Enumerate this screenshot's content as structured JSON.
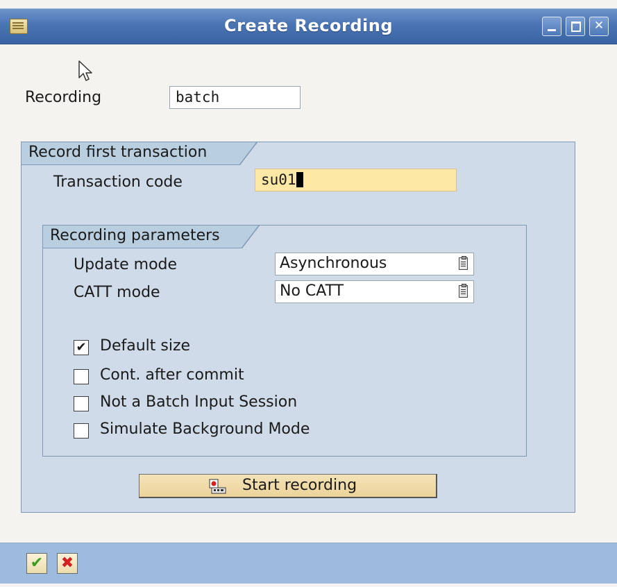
{
  "window": {
    "title": "Create Recording"
  },
  "recording": {
    "label": "Recording",
    "value": "batch"
  },
  "first_transaction": {
    "group_title": "Record first transaction",
    "tcode_label": "Transaction code",
    "tcode_value": "su01"
  },
  "parameters": {
    "group_title": "Recording parameters",
    "update_mode_label": "Update mode",
    "update_mode_value": "Asynchronous",
    "catt_mode_label": "CATT mode",
    "catt_mode_value": "No CATT",
    "checkboxes": [
      {
        "label": "Default size",
        "checked": true
      },
      {
        "label": "Cont. after commit",
        "checked": false
      },
      {
        "label": "Not a Batch Input Session",
        "checked": false
      },
      {
        "label": "Simulate Background Mode",
        "checked": false
      }
    ]
  },
  "actions": {
    "start_recording": "Start recording"
  },
  "icons": {
    "app": "sap-window-icon",
    "minimize": "minimize-icon",
    "maximize": "maximize-icon",
    "close": "close-icon",
    "dropdown": "f4-help-icon",
    "start": "start-recording-icon",
    "ok": "checkmark-icon",
    "cancel": "cancel-icon"
  },
  "colors": {
    "title_bar": "#4a74b4",
    "group_bg": "#cfdbe8",
    "input_highlight": "#fde8a6",
    "button_bg": "#ecd39a",
    "footer": "#9dbbdc",
    "ok_green": "#3a9b1f",
    "cancel_red": "#d42020"
  }
}
